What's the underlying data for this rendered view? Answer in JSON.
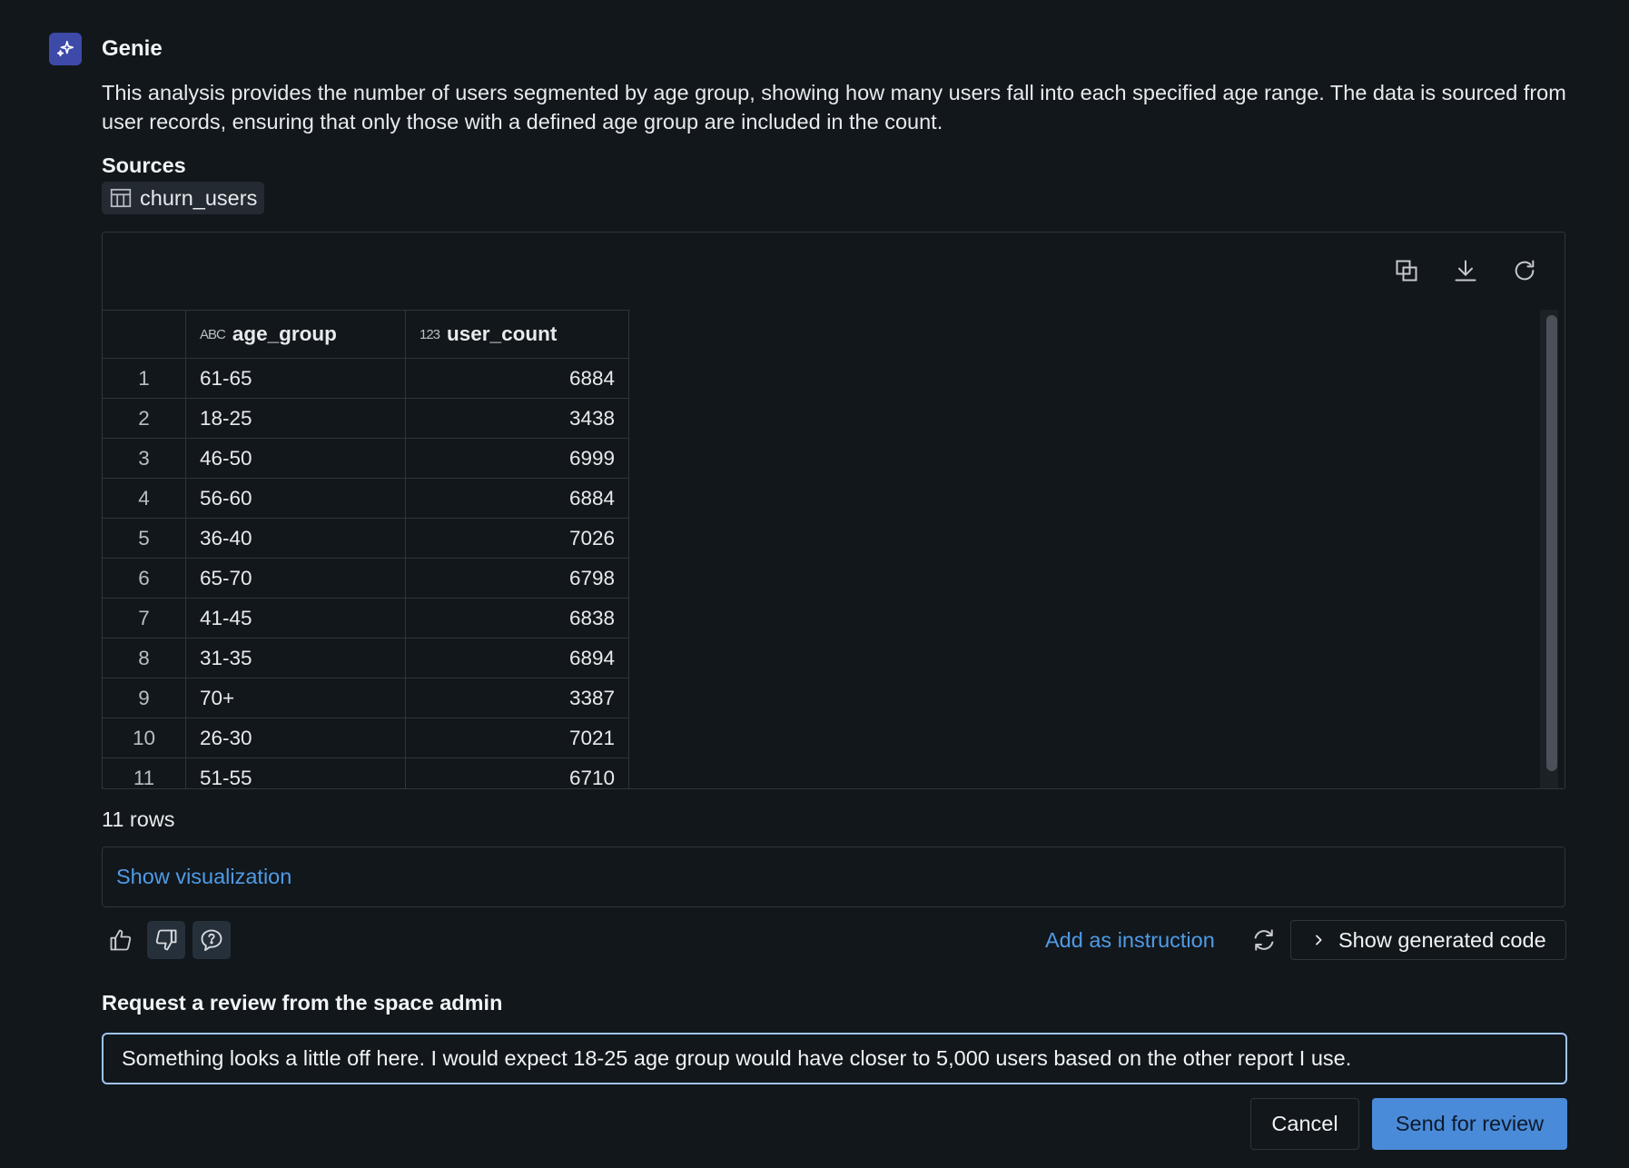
{
  "message": {
    "author": "Genie",
    "description": "This analysis provides the number of users segmented by age group, showing how many users fall into each specified age range. The data is sourced from user records, ensuring that only those with a defined age group are included in the count.",
    "sources_title": "Sources",
    "sources": [
      {
        "name": "churn_users",
        "icon": "table-icon"
      }
    ]
  },
  "toolbar": {
    "icons": [
      "copy-icon",
      "download-icon",
      "refresh-icon"
    ]
  },
  "table": {
    "columns": [
      {
        "name": "age_group",
        "type_glyph": "ABC",
        "type_icon": "string-type-icon"
      },
      {
        "name": "user_count",
        "type_glyph": "123",
        "type_icon": "number-type-icon"
      }
    ],
    "rows": [
      {
        "index": "1",
        "age_group": "61-65",
        "user_count": "6884"
      },
      {
        "index": "2",
        "age_group": "18-25",
        "user_count": "3438"
      },
      {
        "index": "3",
        "age_group": "46-50",
        "user_count": "6999"
      },
      {
        "index": "4",
        "age_group": "56-60",
        "user_count": "6884"
      },
      {
        "index": "5",
        "age_group": "36-40",
        "user_count": "7026"
      },
      {
        "index": "6",
        "age_group": "65-70",
        "user_count": "6798"
      },
      {
        "index": "7",
        "age_group": "41-45",
        "user_count": "6838"
      },
      {
        "index": "8",
        "age_group": "31-35",
        "user_count": "6894"
      },
      {
        "index": "9",
        "age_group": "70+",
        "user_count": "3387"
      },
      {
        "index": "10",
        "age_group": "26-30",
        "user_count": "7021"
      },
      {
        "index": "11",
        "age_group": "51-55",
        "user_count": "6710"
      }
    ],
    "row_count_text": "11 rows"
  },
  "visualization": {
    "show_label": "Show visualization"
  },
  "feedback": {
    "add_instruction_label": "Add as instruction",
    "show_code_label": "Show generated code"
  },
  "review": {
    "title": "Request a review from the space admin",
    "input_value": "Something looks a little off here. I would expect 18-25 age group would have closer to 5,000 users based on the other report I use.",
    "cancel_label": "Cancel",
    "send_label": "Send for review"
  },
  "colors": {
    "accent": "#4a8bd9",
    "link": "#4f9be6",
    "background": "#12171c",
    "avatar": "#3e4aa8"
  }
}
